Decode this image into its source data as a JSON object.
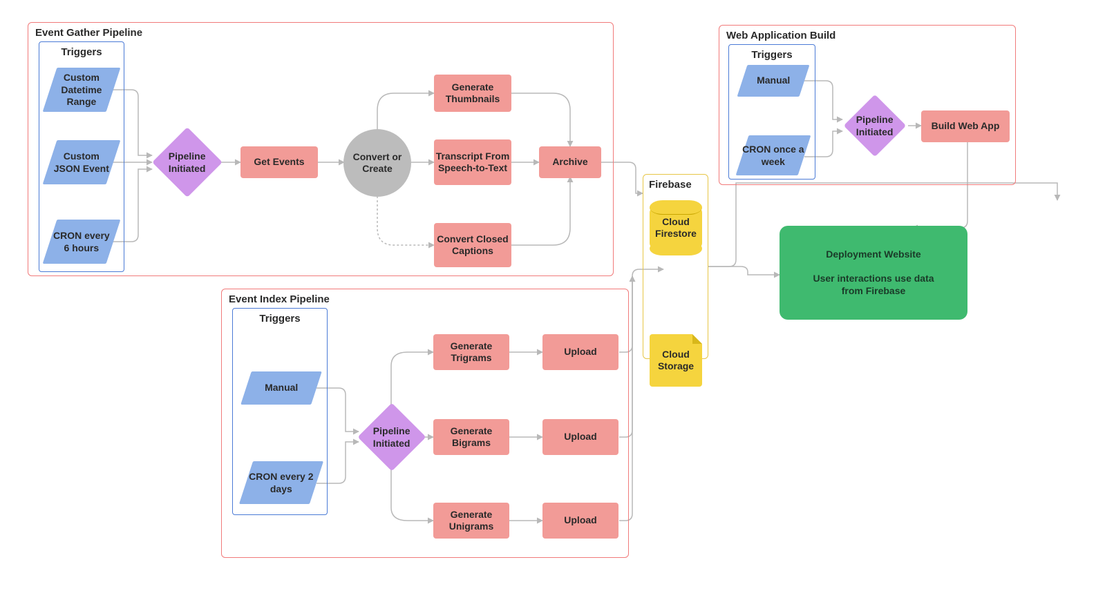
{
  "groups": {
    "gather": {
      "title": "Event Gather Pipeline",
      "triggers_title": "Triggers"
    },
    "index": {
      "title": "Event Index Pipeline",
      "triggers_title": "Triggers"
    },
    "webapp": {
      "title": "Web Application Build",
      "triggers_title": "Triggers"
    },
    "firebase": {
      "title": "Firebase"
    }
  },
  "gather": {
    "triggers": {
      "t1": "Custom Datetime Range",
      "t2": "Custom JSON Event",
      "t3": "CRON every 6 hours"
    },
    "pipeline_initiated": "Pipeline Initiated",
    "get_events": "Get Events",
    "convert_or_create": "Convert or Create",
    "generate_thumbnails": "Generate Thumbnails",
    "transcript_stt": "Transcript From Speech-to-Text",
    "convert_cc": "Convert Closed Captions",
    "archive": "Archive"
  },
  "index": {
    "triggers": {
      "t1": "Manual",
      "t2": "CRON every 2 days"
    },
    "pipeline_initiated": "Pipeline Initiated",
    "gen_tri": "Generate Trigrams",
    "gen_bi": "Generate Bigrams",
    "gen_uni": "Generate Unigrams",
    "upload": "Upload"
  },
  "webapp": {
    "triggers": {
      "t1": "Manual",
      "t2": "CRON once a week"
    },
    "pipeline_initiated": "Pipeline Initiated",
    "build": "Build Web App"
  },
  "firebase": {
    "firestore": "Cloud Firestore",
    "storage": "Cloud Storage"
  },
  "deploy": {
    "line1": "Deployment Website",
    "line2": "User interactions use data from Firebase"
  }
}
